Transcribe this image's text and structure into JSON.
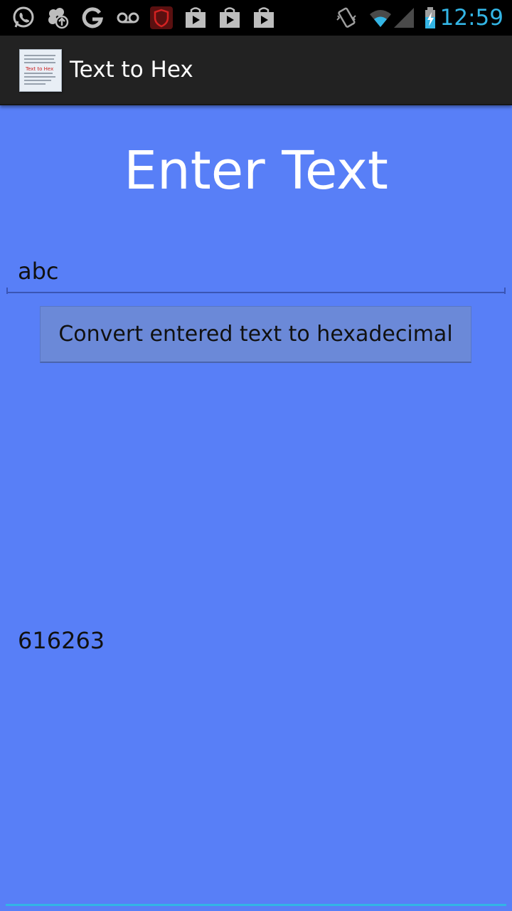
{
  "status_bar": {
    "time": "12:59",
    "icons": [
      "whatsapp-icon",
      "clover-upload-icon",
      "google-icon",
      "voicemail-icon",
      "shield-app-icon",
      "play-store-icon",
      "play-store-bag-icon",
      "play-store-bag-icon",
      "vibrate-icon",
      "wifi-icon",
      "signal-icon",
      "battery-charging-icon"
    ],
    "clock_color": "#33b5e5"
  },
  "action_bar": {
    "title": "Text to Hex",
    "app_icon_text": "Text to Hex"
  },
  "main": {
    "heading": "Enter Text",
    "input_value": "abc",
    "convert_button_label": "Convert entered text to hexadecimal",
    "result": "616263"
  },
  "colors": {
    "background": "#587ff7",
    "action_bar": "#222222",
    "button": "#6b89d8",
    "accent": "#33b5e5"
  }
}
